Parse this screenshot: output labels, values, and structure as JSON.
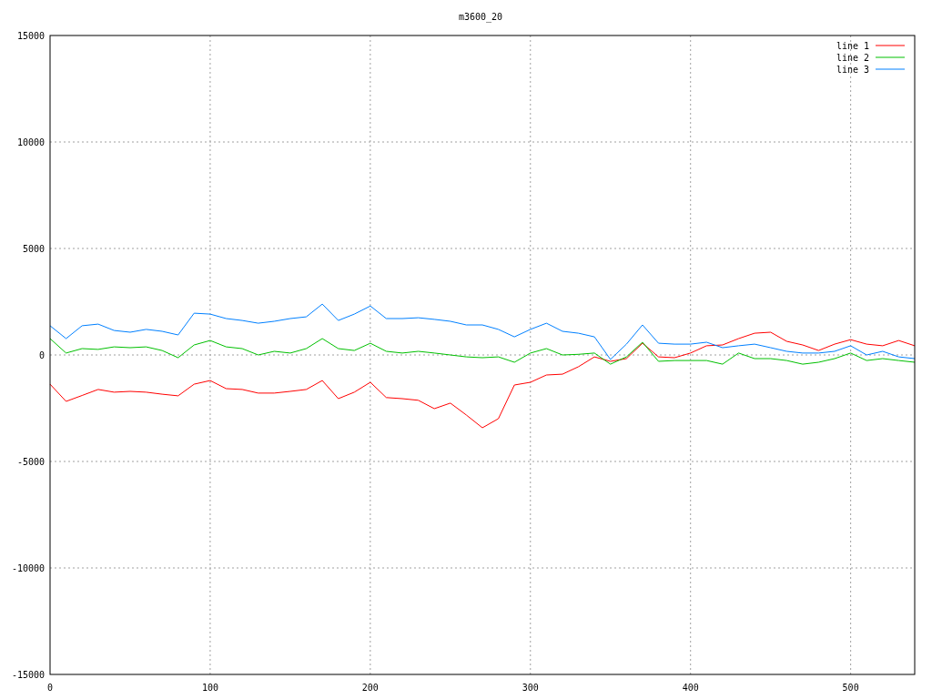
{
  "chart_data": {
    "type": "line",
    "title": "m3600_20",
    "x": [
      0,
      10,
      20,
      30,
      40,
      50,
      60,
      70,
      80,
      90,
      100,
      110,
      120,
      130,
      140,
      150,
      160,
      170,
      180,
      190,
      200,
      210,
      220,
      230,
      240,
      250,
      260,
      270,
      280,
      290,
      300,
      310,
      320,
      330,
      340,
      350,
      360,
      370,
      380,
      390,
      400,
      410,
      420,
      430,
      440,
      450,
      460,
      470,
      480,
      490,
      500,
      510,
      520,
      530,
      540
    ],
    "series": [
      {
        "name": "line 1",
        "color": "#ff0000",
        "values": [
          -1370,
          -2180,
          -1900,
          -1620,
          -1750,
          -1710,
          -1750,
          -1840,
          -1920,
          -1370,
          -1200,
          -1580,
          -1620,
          -1790,
          -1790,
          -1710,
          -1620,
          -1200,
          -2050,
          -1750,
          -1280,
          -2000,
          -2050,
          -2130,
          -2520,
          -2260,
          -2820,
          -3420,
          -2990,
          -1410,
          -1280,
          -940,
          -900,
          -550,
          -90,
          -300,
          -170,
          550,
          -90,
          -130,
          90,
          430,
          470,
          770,
          1020,
          1070,
          640,
          470,
          210,
          510,
          720,
          510,
          430,
          680,
          430
        ]
      },
      {
        "name": "line 2",
        "color": "#00c000",
        "values": [
          770,
          90,
          300,
          260,
          380,
          340,
          380,
          210,
          -130,
          470,
          680,
          380,
          300,
          0,
          170,
          90,
          300,
          770,
          300,
          210,
          550,
          170,
          90,
          170,
          90,
          0,
          -90,
          -130,
          -90,
          -340,
          90,
          300,
          0,
          30,
          90,
          -430,
          -90,
          600,
          -300,
          -260,
          -260,
          -260,
          -430,
          90,
          -170,
          -170,
          -260,
          -430,
          -340,
          -170,
          90,
          -260,
          -170,
          -260,
          -340
        ]
      },
      {
        "name": "line 3",
        "color": "#0080ff",
        "values": [
          1370,
          770,
          1370,
          1450,
          1150,
          1070,
          1200,
          1110,
          940,
          1960,
          1920,
          1710,
          1620,
          1490,
          1580,
          1710,
          1790,
          2390,
          1620,
          1920,
          2300,
          1710,
          1710,
          1750,
          1670,
          1580,
          1410,
          1410,
          1200,
          850,
          1200,
          1490,
          1110,
          1020,
          850,
          -210,
          510,
          1410,
          550,
          510,
          510,
          600,
          340,
          430,
          510,
          340,
          170,
          90,
          90,
          170,
          430,
          0,
          170,
          -90,
          -170
        ]
      }
    ],
    "xlim": [
      0,
      540
    ],
    "ylim": [
      -15000,
      15000
    ],
    "xticks": [
      0,
      100,
      200,
      300,
      400,
      500
    ],
    "yticks": [
      -15000,
      -10000,
      -5000,
      0,
      5000,
      10000,
      15000
    ],
    "grid": true,
    "legend": true
  }
}
